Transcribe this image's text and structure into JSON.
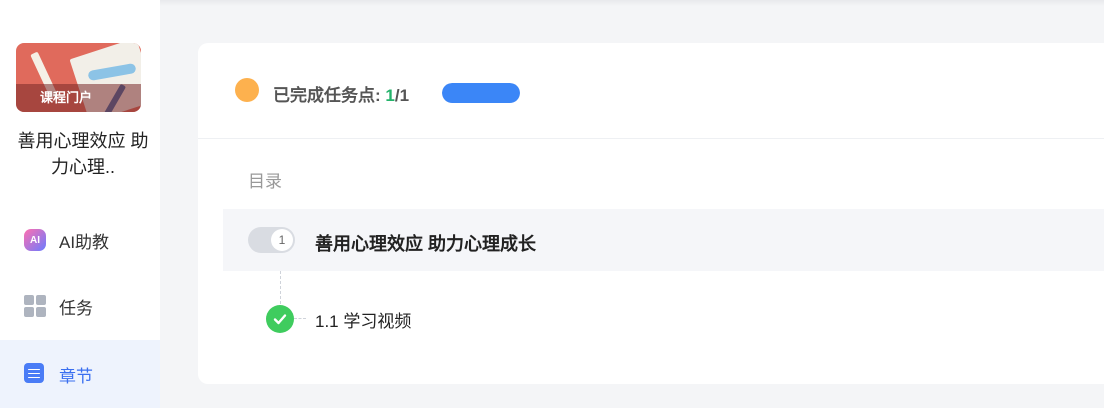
{
  "sidebar": {
    "cover_caption": "课程门户",
    "course_title": "善用心理效应 助力心理..",
    "nav": [
      {
        "label": "AI助教",
        "icon": "ai-assistant-icon"
      },
      {
        "label": "任务",
        "icon": "grid-icon"
      },
      {
        "label": "章节",
        "icon": "list-icon",
        "active": true
      }
    ],
    "ai_badge_text": "AI"
  },
  "progress": {
    "label": "已完成任务点: ",
    "done": "1",
    "total": "/1",
    "fraction": 1.0,
    "accent_color": "#3b86f7"
  },
  "toc": {
    "label": "目录",
    "chapters": [
      {
        "number": "1",
        "title": "善用心理效应 助力心理成长",
        "sections": [
          {
            "title": "1.1 学习视频",
            "status": "completed"
          }
        ]
      }
    ]
  }
}
